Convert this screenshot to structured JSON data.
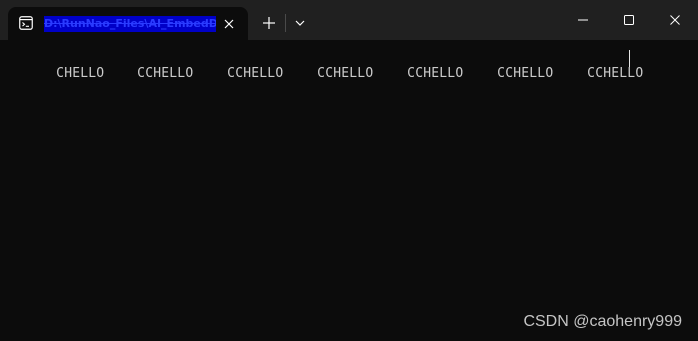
{
  "tab": {
    "title": "D:\\RunNao_Files\\AI_EmbedDe",
    "icon": "terminal-icon"
  },
  "titlebar": {
    "new_tab_icon": "plus-icon",
    "dropdown_icon": "chevron-down-icon",
    "minimize_icon": "minimize-icon",
    "maximize_icon": "maximize-icon",
    "close_icon": "close-icon"
  },
  "terminal": {
    "output": [
      "CHELLO",
      "CCHELLO",
      "CCHELLO",
      "CCHELLO",
      "CCHELLO",
      "CCHELLO",
      "CCHELLO"
    ],
    "text_color": "#cccccc",
    "background": "#0c0c0c"
  },
  "watermark": {
    "text": "CSDN @caohenry999"
  }
}
